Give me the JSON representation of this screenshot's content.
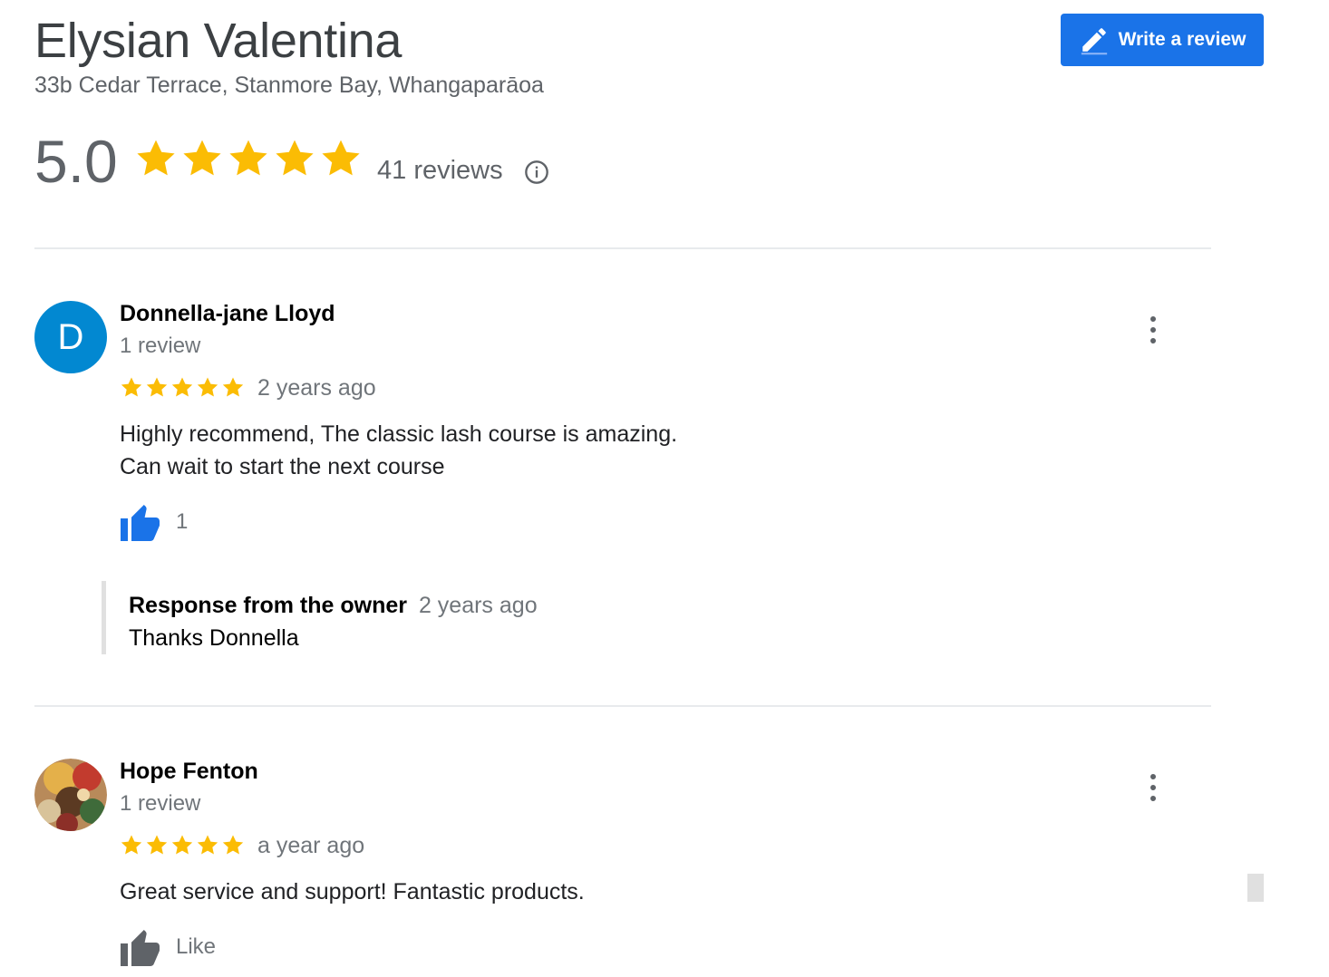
{
  "business": {
    "name": "Elysian Valentina",
    "address": "33b Cedar Terrace, Stanmore Bay, Whangaparāoa",
    "rating": "5.0",
    "stars": 5,
    "review_count": "41 reviews"
  },
  "actions": {
    "write_review_label": "Write a review"
  },
  "colors": {
    "accent": "#1a73e8",
    "star": "#fbbc04",
    "avatar_d": "#0288d1"
  },
  "reviews": [
    {
      "avatar_letter": "D",
      "name": "Donnella-jane Lloyd",
      "meta": "1 review",
      "stars": 5,
      "date": "2 years ago",
      "text_line1": "Highly recommend, The classic lash course is amazing.",
      "text_line2": "Can wait to start the next course",
      "likes": "1",
      "owner_response": {
        "heading": "Response from the owner",
        "date": "2 years ago",
        "text": "Thanks Donnella"
      }
    },
    {
      "avatar_icon": "photo-avatar",
      "name": "Hope Fenton",
      "meta": "1 review",
      "stars": 5,
      "date": "a year ago",
      "text": "Great service and support! Fantastic products.",
      "like_label": "Like"
    }
  ]
}
